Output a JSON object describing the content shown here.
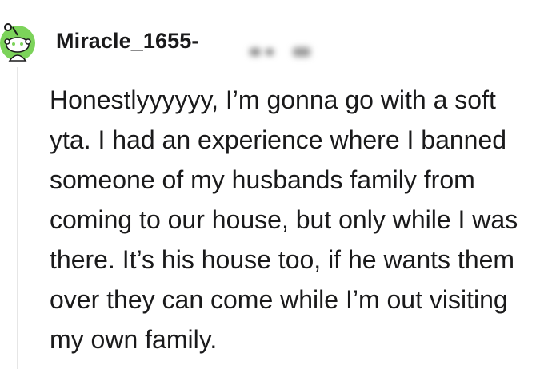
{
  "comment": {
    "username": "Miracle_1655-",
    "avatar_icon": "reddit-snoo-avatar-icon",
    "avatar_color": "#7cd35a",
    "body_lines": [
      "Honestlyyyyyy, I’m gonna go with a soft",
      "yta. I had an experience where I banned",
      "someone of my husbands family from",
      "coming to our house, but only while I was",
      "there. It’s his house too, if he wants them",
      "over they can come while I’m out visiting",
      "my own family."
    ]
  }
}
